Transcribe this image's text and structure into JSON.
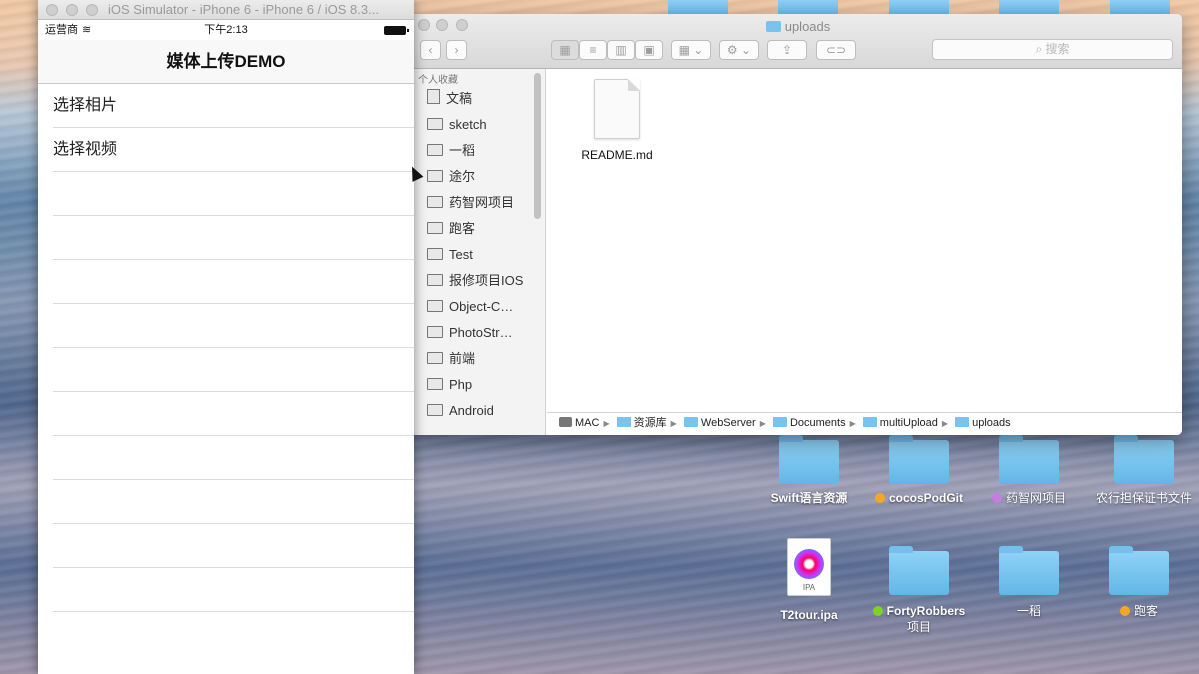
{
  "simulator": {
    "window_title": "iOS Simulator - iPhone 6 - iPhone 6 / iOS 8.3...",
    "carrier": "运营商",
    "time": "下午2:13",
    "nav_title": "媒体上传DEMO",
    "cells": [
      "选择相片",
      "选择视频",
      "",
      "",
      "",
      "",
      "",
      "",
      "",
      "",
      "",
      ""
    ]
  },
  "finder": {
    "title": "uploads",
    "search_placeholder": "搜索",
    "sidebar_header": "个人收藏",
    "sidebar_items": [
      "文稿",
      "sketch",
      "一稻",
      "途尔",
      "药智网项目",
      "跑客",
      "Test",
      "报修项目IOS",
      "Object-C…",
      "PhotoStr…",
      "前端",
      "Php",
      "Android"
    ],
    "file_name": "README.md",
    "path": [
      "MAC",
      "资源库",
      "WebServer",
      "Documents",
      "multiUpload",
      "uploads"
    ]
  },
  "desktop": {
    "icons": [
      {
        "label": "Swift语言资源",
        "tag": ""
      },
      {
        "label": "cocosPodGit",
        "tag": "#f5a623"
      },
      {
        "label": "药智网项目",
        "tag": "#c77ddf"
      },
      {
        "label": "农行担保证书文件",
        "tag": ""
      },
      {
        "label": "T2tour.ipa",
        "tag": ""
      },
      {
        "label": "FortyRobbers",
        "label2": "项目",
        "tag": "#7ed321"
      },
      {
        "label": "一稻",
        "tag": ""
      },
      {
        "label": "跑客",
        "tag": "#f5a623"
      }
    ],
    "ipa_caption": "IPA"
  }
}
